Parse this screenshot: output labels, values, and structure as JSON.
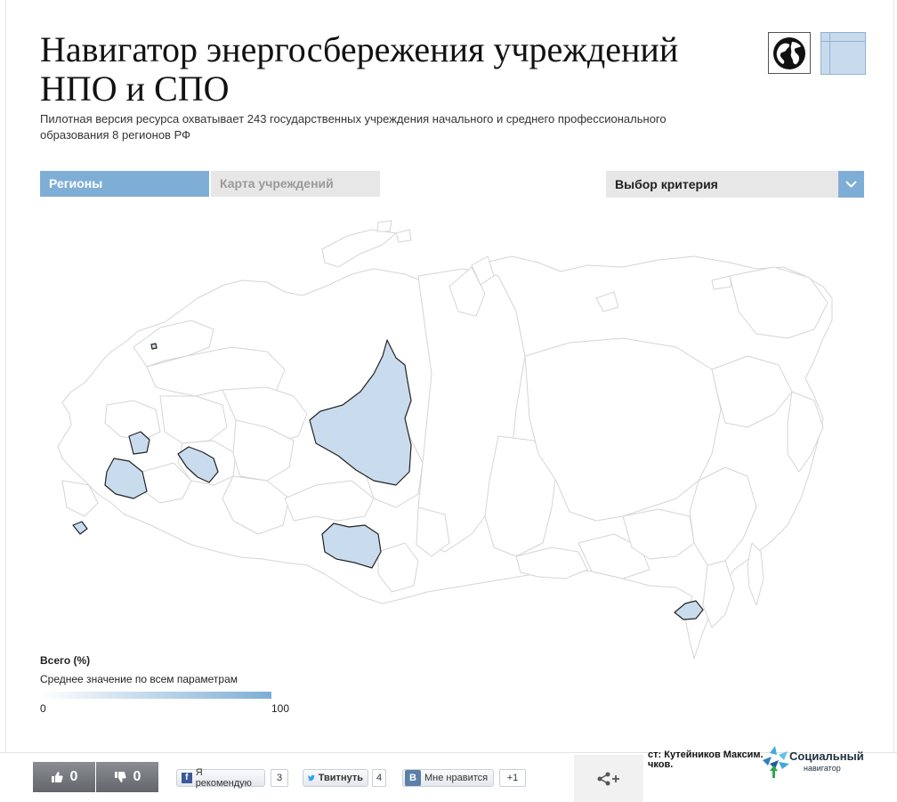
{
  "header": {
    "title": "Навигатор энергосбережения учреждений НПО и СПО",
    "subtitle": "Пилотная версия ресурса охватывает 243 государственных учреждения начального и среднего профессионального образования 8 регионов РФ"
  },
  "view_toggle": {
    "globe_icon": "globe-icon",
    "table_icon": "table-icon"
  },
  "tabs": [
    {
      "label": "Регионы",
      "active": true
    },
    {
      "label": "Карта учреждений",
      "active": false
    }
  ],
  "criteria_select": {
    "label": "Выбор критерия",
    "icon": "chevron-down-icon"
  },
  "map": {
    "highlight_color": "#c9dcee",
    "outline_color": "#d5d5d5",
    "highlighted_region_count": 8
  },
  "legend": {
    "title": "Всего (%)",
    "subtitle": "Среднее значение по всем параметрам",
    "min": "0",
    "max": "100",
    "color_min": "#ffffff",
    "color_max": "#7eaed6"
  },
  "footer": {
    "like_count": "0",
    "dislike_count": "0",
    "fb_label": "Я рекомендую",
    "fb_count": "3",
    "tw_label": "Твитнуть",
    "tw_count": "4",
    "vk_label": "Мне нравится",
    "plus_label": "+1",
    "credits_line1": "ст: Кутейников Максим.",
    "credits_line2": "чков.",
    "logo_line1": "Социальный",
    "logo_line2": "навигатор"
  }
}
